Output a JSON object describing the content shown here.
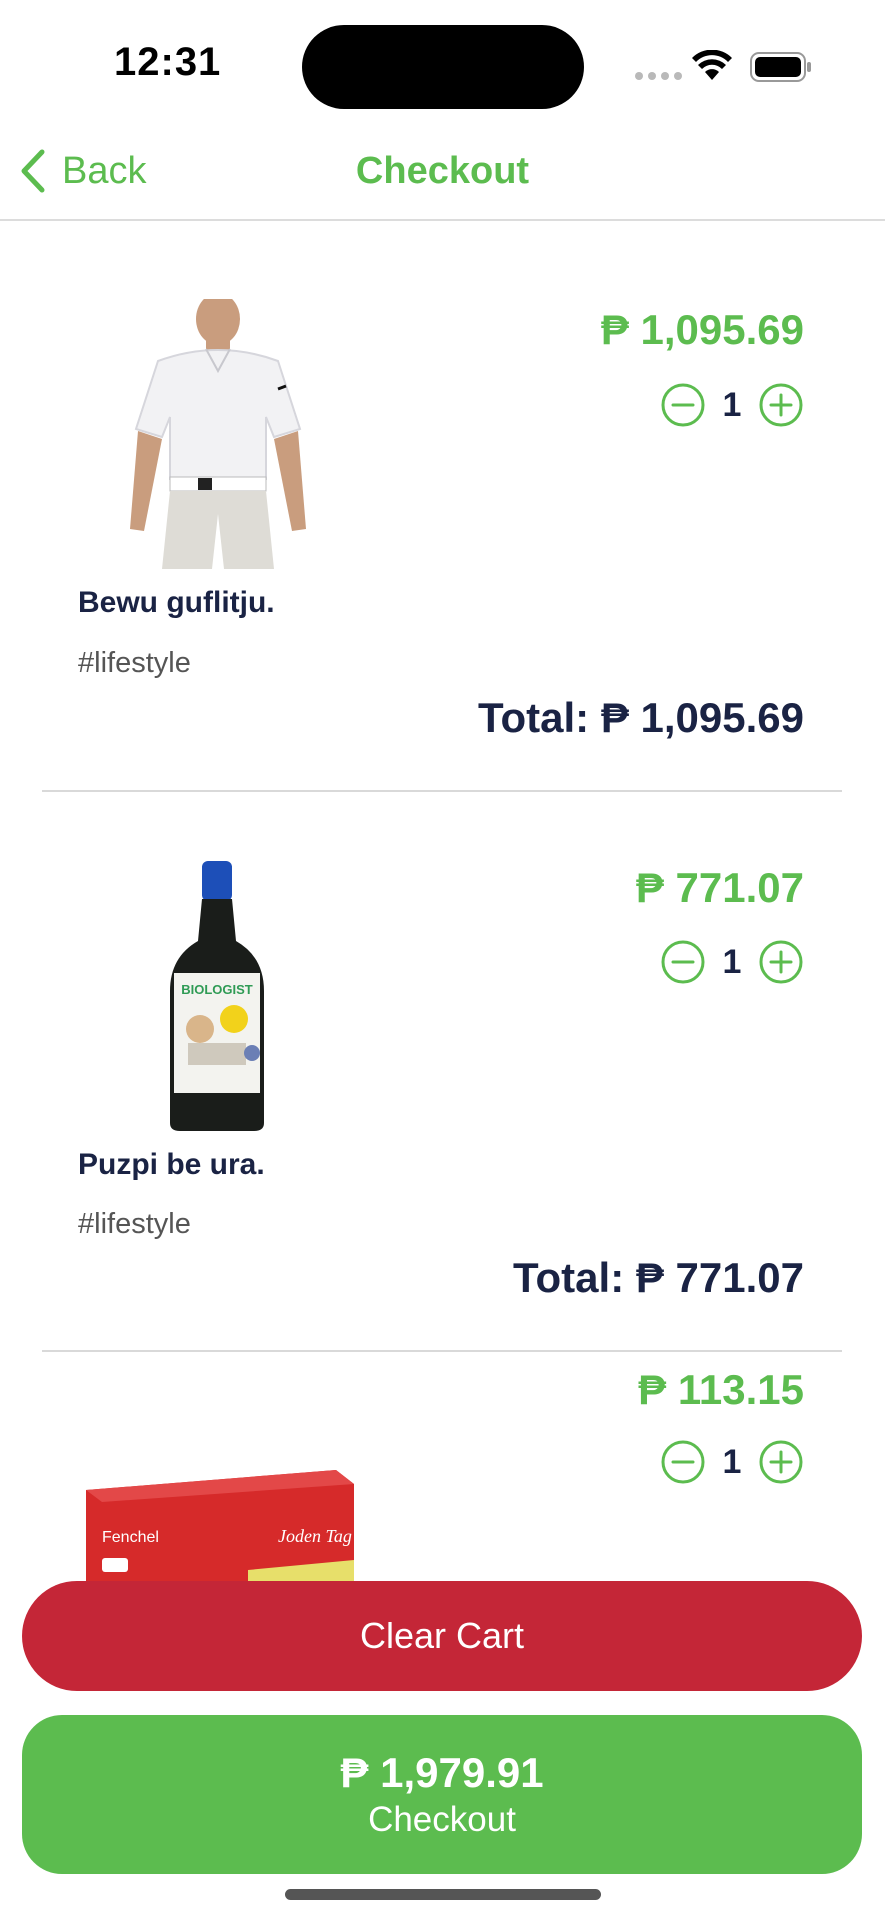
{
  "status_bar": {
    "time": "12:31"
  },
  "nav": {
    "back_label": "Back",
    "title": "Checkout"
  },
  "cart": {
    "items": [
      {
        "name": "Bewu guflitju.",
        "tag": "#lifestyle",
        "price": "₱ 1,095.69",
        "quantity": "1",
        "total": "Total: ₱ 1,095.69",
        "image_icon": "shirt-image"
      },
      {
        "name": "Puzpi be ura.",
        "tag": "#lifestyle",
        "price": "₱ 771.07",
        "quantity": "1",
        "total": "Total: ₱ 771.07",
        "image_icon": "wine-bottle-image"
      },
      {
        "name": "",
        "tag": "",
        "price": "₱ 113.15",
        "quantity": "1",
        "total": "",
        "image_icon": "tea-box-image",
        "image_text": "Fenchel"
      }
    ]
  },
  "actions": {
    "clear_label": "Clear Cart",
    "checkout_total": "₱ 1,979.91",
    "checkout_label": "Checkout"
  },
  "colors": {
    "accent_green": "#5cbc4f",
    "danger_red": "#c42637",
    "text_dark": "#1a2344"
  }
}
